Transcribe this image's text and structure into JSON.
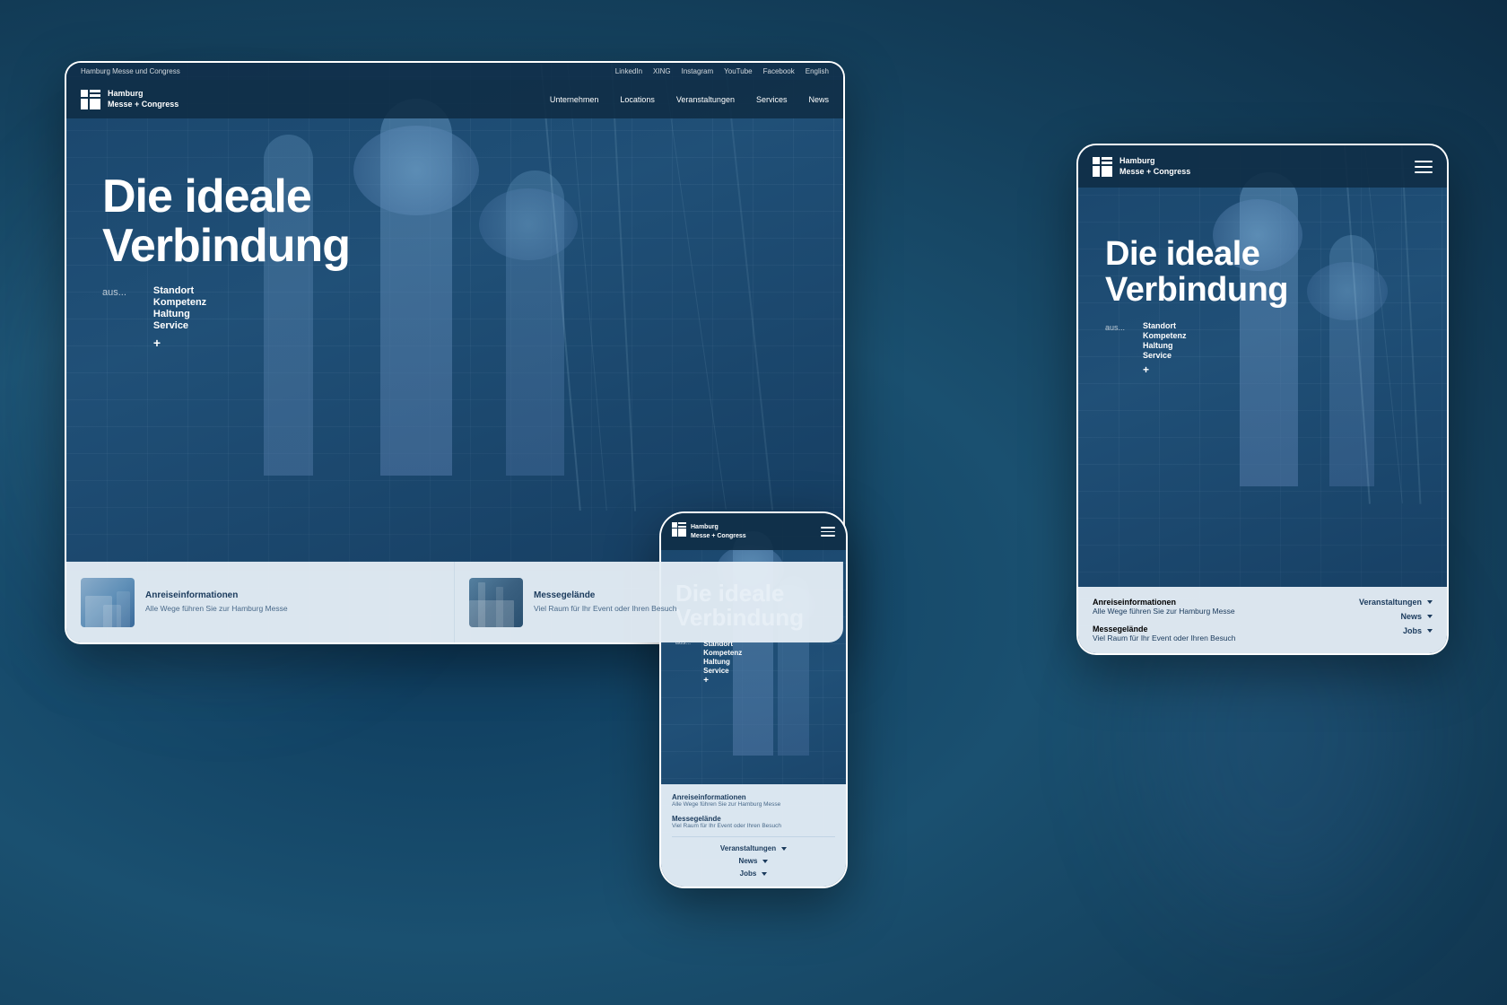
{
  "brand": {
    "name_line1": "Hamburg",
    "name_line2": "Messe + Congress",
    "site_name": "Hamburg Messe und Congress"
  },
  "topbar": {
    "social_links": [
      "LinkedIn",
      "XING",
      "Instagram",
      "YouTube",
      "Facebook"
    ],
    "language": "English"
  },
  "nav": {
    "items": [
      {
        "label": "Unternehmen"
      },
      {
        "label": "Locations"
      },
      {
        "label": "Veranstaltungen"
      },
      {
        "label": "Services"
      },
      {
        "label": "News"
      }
    ]
  },
  "hero": {
    "title_line1": "Die ideale",
    "title_line2": "Verbindung",
    "aus_label": "aus...",
    "keywords": [
      "Standort",
      "Kompetenz",
      "Haltung",
      "Service"
    ],
    "plus": "+"
  },
  "bottom_cards": [
    {
      "title": "Anreiseinformationen",
      "description": "Alle Wege führen Sie zur Hamburg Messe"
    },
    {
      "title": "Messegelände",
      "description": "Viel Raum für Ihr Event oder Ihren Besuch"
    }
  ],
  "quick_links": [
    {
      "label": "Veranstaltungen"
    },
    {
      "label": "News"
    },
    {
      "label": "Jobs"
    }
  ],
  "background": {
    "primary": "#1a4a6b",
    "card_bg": "#e6eef5",
    "nav_bg": "rgba(15,45,70,0.9)"
  }
}
